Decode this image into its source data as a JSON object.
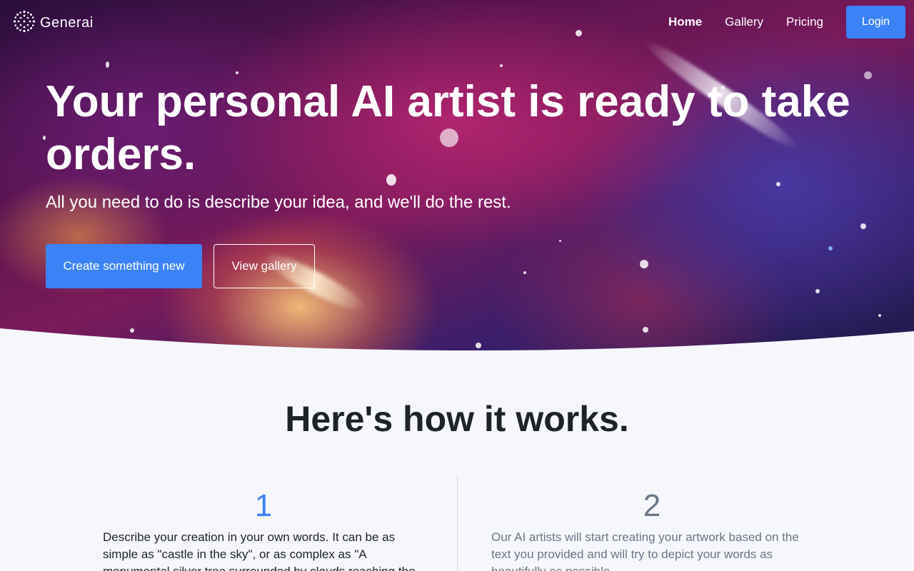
{
  "brand": {
    "name": "Generai",
    "logo_icon": "dotted-sphere-icon"
  },
  "nav": {
    "links": [
      {
        "label": "Home",
        "active": true
      },
      {
        "label": "Gallery",
        "active": false
      },
      {
        "label": "Pricing",
        "active": false
      }
    ],
    "login_label": "Login"
  },
  "hero": {
    "title": "Your personal AI artist is ready to take orders.",
    "subtitle": "All you need to do is describe your idea, and we'll do the rest.",
    "primary_cta": "Create something new",
    "secondary_cta": "View gallery"
  },
  "how_it_works": {
    "title": "Here's how it works.",
    "steps": [
      {
        "number": "1",
        "text": "Describe your creation in your own words. It can be as simple as \"castle in the sky\", or as complex as \"A monumental silver tree surrounded by clouds reaching the"
      },
      {
        "number": "2",
        "text": "Our AI artists will start creating your artwork based on the text you provided and will try to depict your words as beautifully as possible."
      }
    ]
  },
  "colors": {
    "accent": "#3b82f6",
    "page_bg": "#f5f7fb",
    "muted_text": "#6b7686"
  }
}
